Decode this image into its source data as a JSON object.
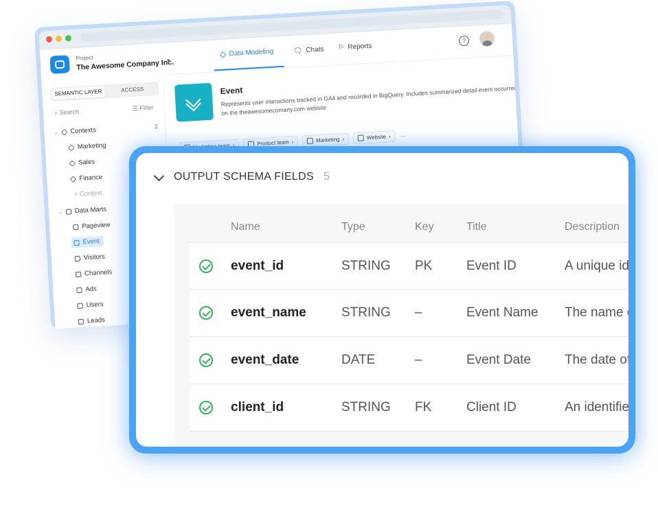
{
  "header": {
    "project_label": "Project",
    "project_name": "The Awesome Company Inc.",
    "tabs": [
      {
        "label": "Data Modeling",
        "icon": "cube-icon",
        "active": true
      },
      {
        "label": "Chats",
        "icon": "chat-icon",
        "active": false
      },
      {
        "label": "Reports",
        "icon": "report-icon",
        "active": false
      }
    ],
    "help_glyph": "?"
  },
  "sidebar": {
    "segments": [
      "SEMANTIC LAYER",
      "ACCESS"
    ],
    "search_placeholder": "Search",
    "filter_label": "Filter",
    "contexts": {
      "label": "Contexts",
      "count": "3",
      "items": [
        "Marketing",
        "Sales",
        "Finance"
      ],
      "add_label": "+ Context"
    },
    "data_marts": {
      "label": "Data Marts",
      "items": [
        "Pageview",
        "Event",
        "Visitors",
        "Channels",
        "Ads",
        "Users",
        "Leads"
      ],
      "selected": "Event"
    }
  },
  "entity": {
    "title": "Event",
    "description": "Represents user interactions tracked in GA4 and recorded in BigQuery. Includes summarized detail event occurred on the theawesomecomany.com website",
    "chips": [
      "Marketing team",
      "Product team",
      "Marketing",
      "Website"
    ],
    "more": "···",
    "icon_color": "#17b0c4"
  },
  "schema": {
    "title": "OUTPUT SCHEMA FIELDS",
    "count": "5",
    "columns": [
      "Name",
      "Type",
      "Key",
      "Title",
      "Description"
    ],
    "rows": [
      {
        "name": "event_id",
        "type": "STRING",
        "key": "PK",
        "title": "Event ID",
        "description": "A unique id"
      },
      {
        "name": "event_name",
        "type": "STRING",
        "key": "–",
        "title": "Event Name",
        "description": "The name o"
      },
      {
        "name": "event_date",
        "type": "DATE",
        "key": "–",
        "title": "Event Date",
        "description": "The date of"
      },
      {
        "name": "client_id",
        "type": "STRING",
        "key": "FK",
        "title": "Client ID",
        "description": "An identifie"
      }
    ]
  },
  "colors": {
    "accent": "#1e88e5",
    "card_border": "#4aa3f5",
    "check_green": "#34b35a"
  }
}
